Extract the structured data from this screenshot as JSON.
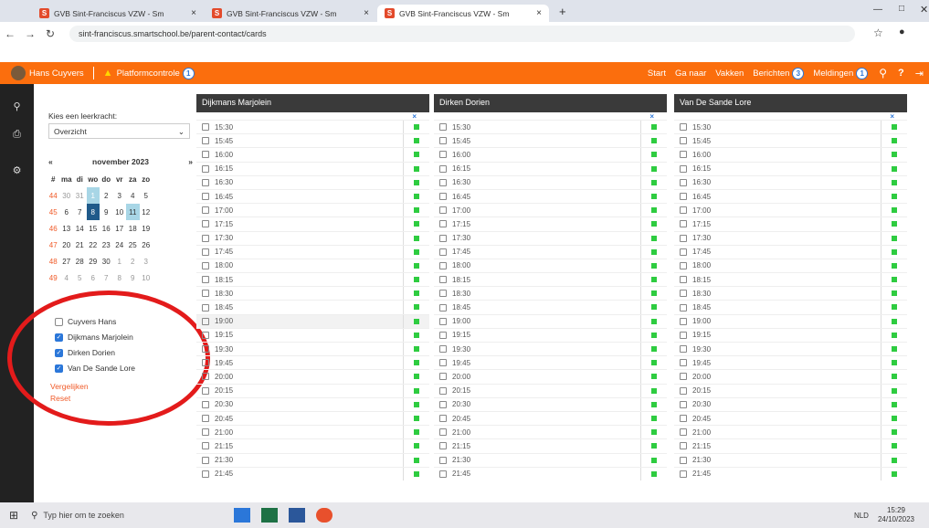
{
  "browser": {
    "tabs": [
      {
        "label": "GVB Sint-Franciscus VZW - Sm"
      },
      {
        "label": "GVB Sint-Franciscus VZW - Sm"
      },
      {
        "label": "GVB Sint-Franciscus VZW - Sm"
      }
    ],
    "url": "sint-franciscus.smartschool.be/parent-contact/cards"
  },
  "topbar": {
    "user": "Hans Cuyvers",
    "platform": "Platformcontrole",
    "platform_count": "1",
    "start": "Start",
    "ganaar": "Ga naar",
    "vakken": "Vakken",
    "berichten": "Berichten",
    "berichten_count": "3",
    "meldingen": "Meldingen",
    "meldingen_count": "1"
  },
  "sidebar": {
    "prompt": "Kies een leerkracht:",
    "select": "Overzicht",
    "month": "november 2023",
    "prev": "«",
    "next": "»",
    "weekdays": [
      "#",
      "ma",
      "di",
      "wo",
      "do",
      "vr",
      "za",
      "zo"
    ],
    "weeks": [
      [
        "44",
        "30",
        "31",
        "1",
        "2",
        "3",
        "4",
        "5"
      ],
      [
        "45",
        "6",
        "7",
        "8",
        "9",
        "10",
        "11",
        "12"
      ],
      [
        "46",
        "13",
        "14",
        "15",
        "16",
        "17",
        "18",
        "19"
      ],
      [
        "47",
        "20",
        "21",
        "22",
        "23",
        "24",
        "25",
        "26"
      ],
      [
        "48",
        "27",
        "28",
        "29",
        "30",
        "1",
        "2",
        "3"
      ],
      [
        "49",
        "4",
        "5",
        "6",
        "7",
        "8",
        "9",
        "10"
      ]
    ],
    "teachers": [
      {
        "name": "Cuyvers Hans",
        "checked": false
      },
      {
        "name": "Dijkmans Marjolein",
        "checked": true
      },
      {
        "name": "Dirken Dorien",
        "checked": true
      },
      {
        "name": "Van De Sande Lore",
        "checked": true
      }
    ],
    "compare": "Vergelijken",
    "reset": "Reset"
  },
  "columns": [
    {
      "name": "Dijkmans Marjolein"
    },
    {
      "name": "Dirken Dorien"
    },
    {
      "name": "Van De Sande Lore"
    }
  ],
  "times": [
    "15:30",
    "15:45",
    "16:00",
    "16:15",
    "16:30",
    "16:45",
    "17:00",
    "17:15",
    "17:30",
    "17:45",
    "18:00",
    "18:15",
    "18:30",
    "18:45",
    "19:00",
    "19:15",
    "19:30",
    "19:45",
    "20:00",
    "20:15",
    "20:30",
    "20:45",
    "21:00",
    "21:15",
    "21:30",
    "21:45"
  ],
  "taskbar": {
    "search": "Typ hier om te zoeken",
    "time": "15:29",
    "date": "24/10/2023",
    "lang": "NLD"
  }
}
